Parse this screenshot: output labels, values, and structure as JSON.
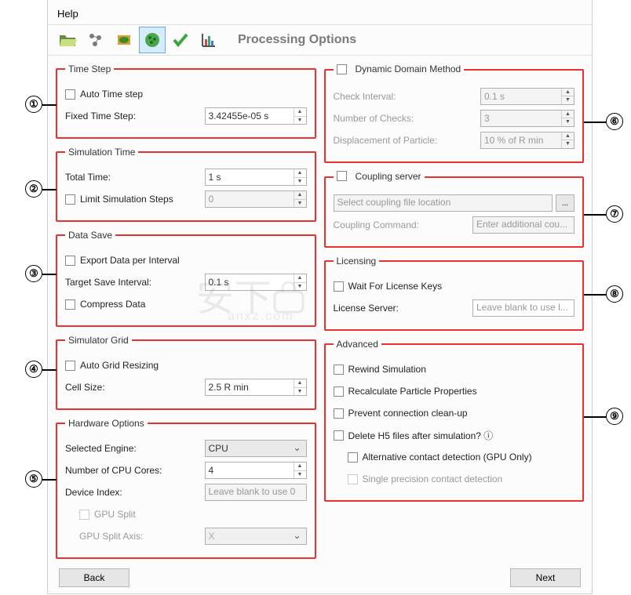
{
  "menu": {
    "help": "Help"
  },
  "header": {
    "title": "Processing Options"
  },
  "timeStep": {
    "legend": "Time Step",
    "auto": "Auto Time step",
    "fixedLabel": "Fixed Time Step:",
    "fixedValue": "3.42455e-05 s"
  },
  "simTime": {
    "legend": "Simulation Time",
    "totalLabel": "Total Time:",
    "totalValue": "1 s",
    "limitLabel": "Limit Simulation Steps",
    "limitValue": "0"
  },
  "dataSave": {
    "legend": "Data Save",
    "export": "Export Data per Interval",
    "targetLabel": "Target Save Interval:",
    "targetValue": "0.1 s",
    "compress": "Compress Data"
  },
  "grid": {
    "legend": "Simulator Grid",
    "auto": "Auto Grid Resizing",
    "cellLabel": "Cell Size:",
    "cellValue": "2.5 R min"
  },
  "hw": {
    "legend": "Hardware Options",
    "engineLabel": "Selected Engine:",
    "engineValue": "CPU",
    "coresLabel": "Number of CPU Cores:",
    "coresValue": "4",
    "deviceLabel": "Device Index:",
    "devicePlaceholder": "Leave blank to use 0",
    "gpuSplit": "GPU Split",
    "gpuAxisLabel": "GPU Split Axis:",
    "gpuAxisValue": "X"
  },
  "ddm": {
    "legend": "Dynamic Domain Method",
    "checkLabel": "Check Interval:",
    "checkValue": "0.1 s",
    "numLabel": "Number of Checks:",
    "numValue": "3",
    "dispLabel": "Displacement of Particle:",
    "dispValue": "10 % of R min"
  },
  "coupling": {
    "legend": "Coupling server",
    "filePlaceholder": "Select coupling file location",
    "cmdLabel": "Coupling Command:",
    "cmdPlaceholder": "Enter additional cou..."
  },
  "licensing": {
    "legend": "Licensing",
    "wait": "Wait For License Keys",
    "serverLabel": "License Server:",
    "serverPlaceholder": "Leave blank to use l..."
  },
  "advanced": {
    "legend": "Advanced",
    "rewind": "Rewind Simulation",
    "recalc": "Recalculate Particle Properties",
    "prevent": "Prevent connection clean-up",
    "deleteH5": "Delete H5 files after simulation? ⓘ",
    "altContact": "Alternative contact detection (GPU Only)",
    "single": "Single precision contact detection"
  },
  "footer": {
    "back": "Back",
    "next": "Next"
  }
}
